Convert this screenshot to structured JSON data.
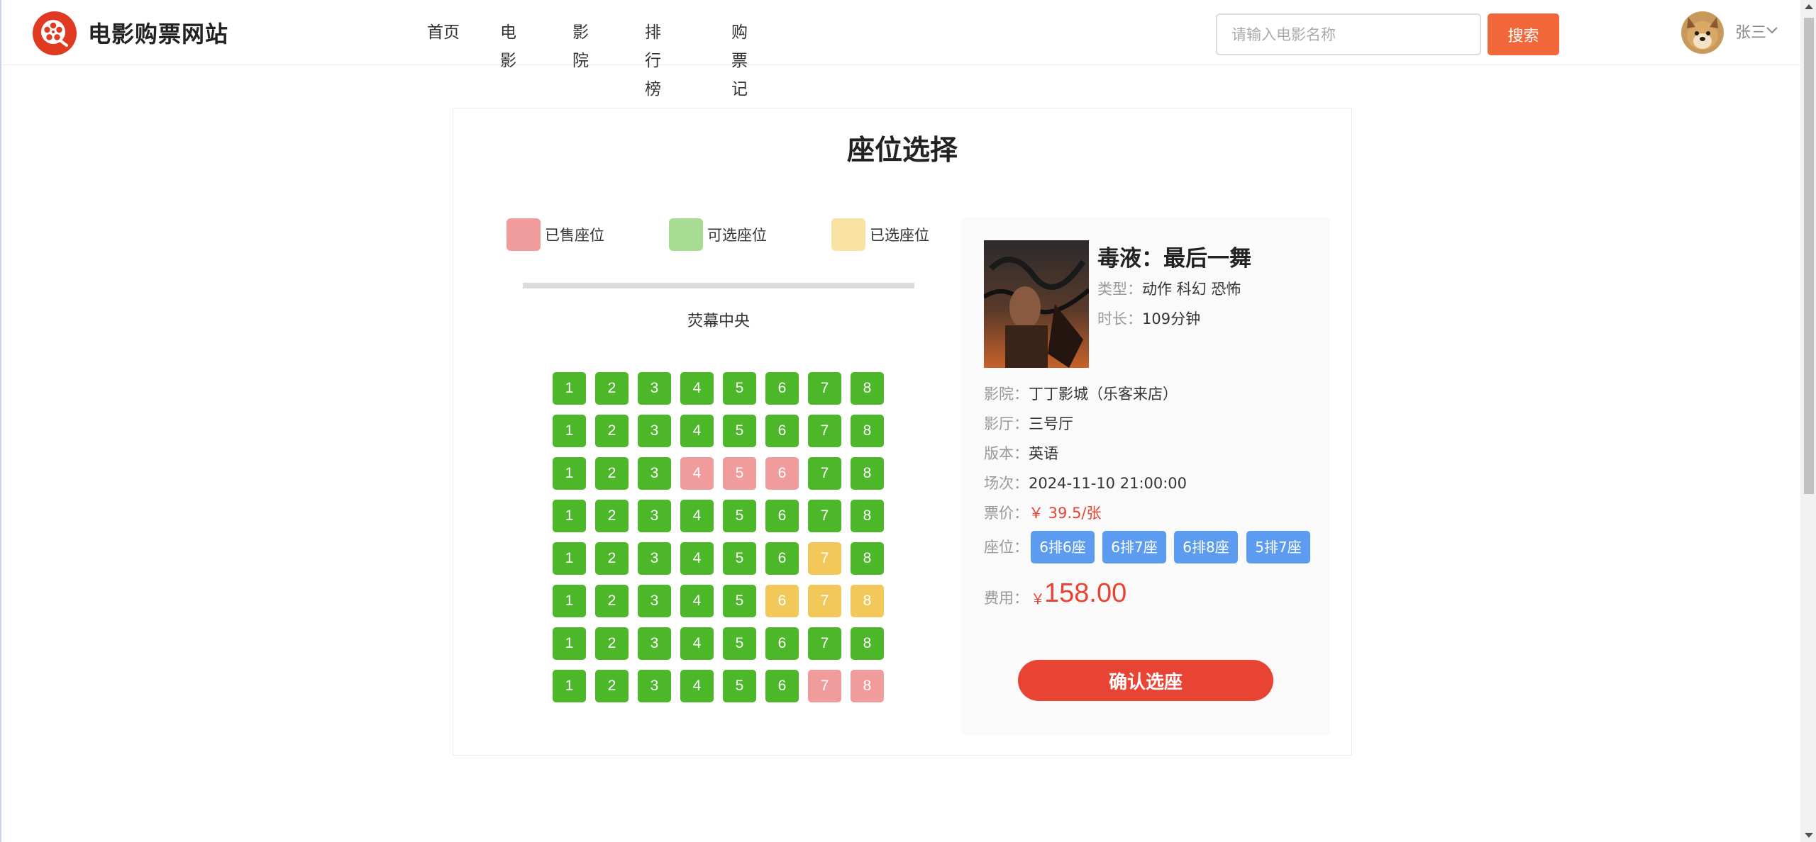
{
  "header": {
    "site_title": "电影购票网站",
    "nav": [
      "首页",
      "电影",
      "影院",
      "排行榜",
      "购票记录"
    ],
    "search": {
      "placeholder": "请输入电影名称",
      "value": "",
      "button_label": "搜索"
    },
    "user": {
      "name": "张三"
    }
  },
  "seat_selection": {
    "title": "座位选择",
    "legend": [
      {
        "label": "已售座位",
        "color": "#f09b9c"
      },
      {
        "label": "可选座位",
        "color": "#a9dc93"
      },
      {
        "label": "已选座位",
        "color": "#f9e3a4"
      }
    ],
    "screen_label": "荧幕中央",
    "rows": [
      [
        "available",
        "available",
        "available",
        "available",
        "available",
        "available",
        "available",
        "available"
      ],
      [
        "available",
        "available",
        "available",
        "available",
        "available",
        "available",
        "available",
        "available"
      ],
      [
        "available",
        "available",
        "available",
        "sold",
        "sold",
        "sold",
        "available",
        "available"
      ],
      [
        "available",
        "available",
        "available",
        "available",
        "available",
        "available",
        "available",
        "available"
      ],
      [
        "available",
        "available",
        "available",
        "available",
        "available",
        "available",
        "selected",
        "available"
      ],
      [
        "available",
        "available",
        "available",
        "available",
        "available",
        "selected",
        "selected",
        "selected"
      ],
      [
        "available",
        "available",
        "available",
        "available",
        "available",
        "available",
        "available",
        "available"
      ],
      [
        "available",
        "available",
        "available",
        "available",
        "available",
        "available",
        "sold",
        "sold"
      ]
    ],
    "seat_numbers": [
      "1",
      "2",
      "3",
      "4",
      "5",
      "6",
      "7",
      "8"
    ]
  },
  "order": {
    "movie_title": "毒液：最后一舞",
    "genre_label": "类型：",
    "genre": "动作 科幻 恐怖",
    "duration_label": "时长：",
    "duration": "109分钟",
    "cinema_label": "影院：",
    "cinema": "丁丁影城（乐客来店）",
    "hall_label": "影厅：",
    "hall": "三号厅",
    "version_label": "版本：",
    "version": "英语",
    "showtime_label": "场次：",
    "showtime": "2024-11-10 21:00:00",
    "price_label": "票价：",
    "price": "￥ 39.5/张",
    "seats_label": "座位：",
    "seats": [
      "6排6座",
      "6排7座",
      "6排8座",
      "5排7座"
    ],
    "fee_label": "费用：",
    "fee_currency": "￥",
    "fee": "158.00",
    "confirm_label": "确认选座"
  }
}
